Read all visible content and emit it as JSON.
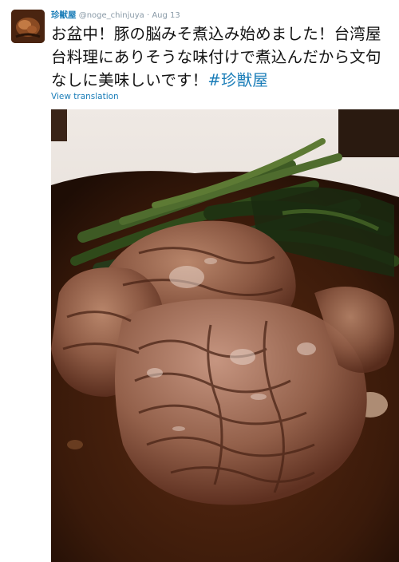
{
  "tweet": {
    "display_name": "珍獣屋",
    "handle": "@noge_chinjuya",
    "separator": "·",
    "date": "Aug 13",
    "text_main": "お盆中！豚の脳みそ煮込み始めました！台湾屋台料理にありそうな味付けで煮込んだから文句なしに美味しいです！",
    "hashtag": "#珍獣屋",
    "view_translation": "View translation",
    "avatar_icon": "restaurant-logo-icon",
    "media_icon": "braised-pork-brain-photo"
  },
  "colors": {
    "link": "#1a7db8",
    "text": "#111111",
    "muted": "#8899a6"
  }
}
